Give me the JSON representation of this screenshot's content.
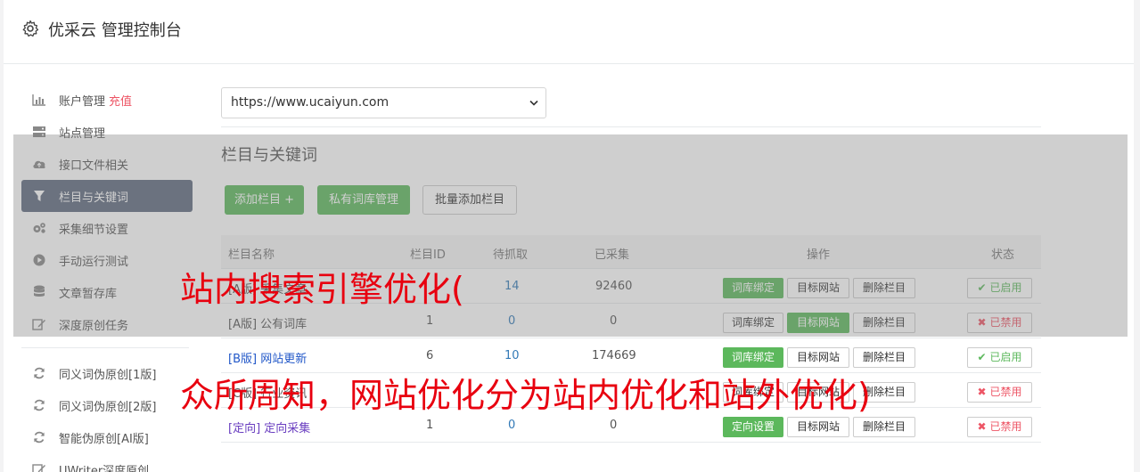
{
  "app": {
    "title": "优采云 管理控制台"
  },
  "sidebar": {
    "items": [
      {
        "label": "账户管理",
        "badge": "充值",
        "icon": "bar-chart-icon"
      },
      {
        "label": "站点管理",
        "icon": "server-icon"
      },
      {
        "label": "接口文件相关",
        "icon": "cloud-upload-icon"
      },
      {
        "label": "栏目与关键词",
        "icon": "filter-icon",
        "active": true
      },
      {
        "label": "采集细节设置",
        "icon": "gears-icon"
      },
      {
        "label": "手动运行测试",
        "icon": "play-circle-icon"
      },
      {
        "label": "文章暂存库",
        "icon": "database-icon"
      },
      {
        "label": "深度原创任务",
        "icon": "edit-icon"
      }
    ],
    "tools": [
      {
        "label": "同义词伪原创[1版]",
        "icon": "refresh-icon"
      },
      {
        "label": "同义词伪原创[2版]",
        "icon": "refresh-icon"
      },
      {
        "label": "智能伪原创[AI版]",
        "icon": "refresh-icon"
      },
      {
        "label": "UWriter深度原创",
        "icon": "edit-icon"
      }
    ]
  },
  "site_select": {
    "value": "https://www.ucaiyun.com"
  },
  "section": {
    "title": "栏目与关键词",
    "add_column": "添加栏目 +",
    "private_lexicon": "私有词库管理",
    "batch_add": "批量添加栏目"
  },
  "table": {
    "headers": {
      "name": "栏目名称",
      "id": "栏目ID",
      "pending": "待抓取",
      "collected": "已采集",
      "ops": "操作",
      "status": "状态"
    },
    "buttons": {
      "lexicon_bind": "词库绑定",
      "directed_setting": "定向设置",
      "target_site": "目标网站",
      "delete_column": "删除栏目"
    },
    "rows": [
      {
        "name": "[A版] 采集文章",
        "id": "",
        "pending": "14",
        "collected": "92460",
        "status": "已启用"
      },
      {
        "name": "[A版] 公有词库",
        "id": "1",
        "pending": "0",
        "collected": "0",
        "status": "已禁用"
      },
      {
        "name": "[B版] 网站更新",
        "id": "6",
        "pending": "10",
        "collected": "174669",
        "status": "已启用"
      },
      {
        "name": "[C版] 行业资讯",
        "id": "",
        "pending": "",
        "collected": "",
        "status": "已禁用"
      },
      {
        "name": "[定向] 定向采集",
        "id": "1",
        "pending": "0",
        "collected": "0",
        "status": "已禁用"
      }
    ]
  },
  "watermark": {
    "line1": "站内搜索引擎优化(",
    "line2": "众所周知，网站优化分为站内优化和站外优化)"
  },
  "colors": {
    "green": "#5cb85c",
    "red": "#ed5565",
    "sidebar_active": "#5e6a7e",
    "watermark": "#e8000f"
  }
}
